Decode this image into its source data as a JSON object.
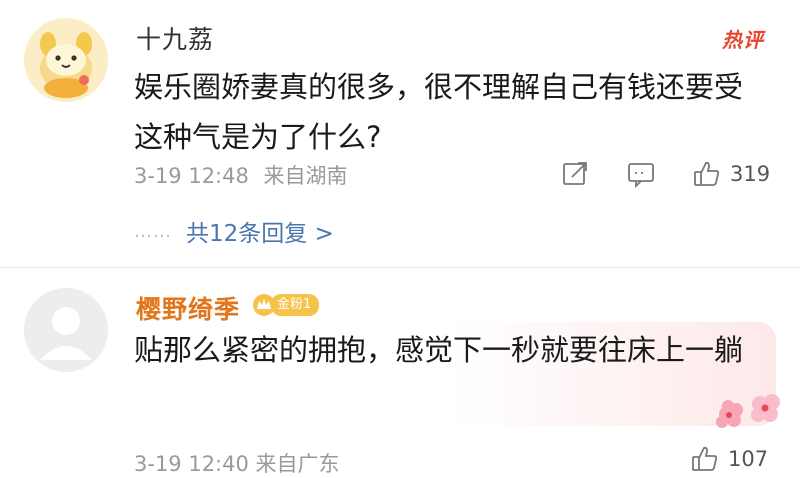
{
  "comments": [
    {
      "username": "十九荔",
      "badge": "热评",
      "text": "娱乐圈娇妻真的很多，很不理解自己有钱还要受这种气是为了什么?",
      "date": "3-19 12:48",
      "location": "来自湖南",
      "likes": "319",
      "replies_label": "共12条回复 >",
      "replies_dots": "……"
    },
    {
      "username": "樱野绮季",
      "fan_badge": "金粉1",
      "text": "贴那么紧密的拥抱，感觉下一秒就要往床上一躺",
      "meta_partial": "3-19 12:40 来自广东",
      "likes_partial": "107"
    }
  ],
  "colors": {
    "username_vip": "#e2761c",
    "hot_badge": "#e8472f",
    "link": "#4a76b0",
    "meta": "#9a9a9a"
  },
  "icons": {
    "share": "share-icon",
    "comment": "comment-icon",
    "like": "thumbs-up-icon"
  }
}
